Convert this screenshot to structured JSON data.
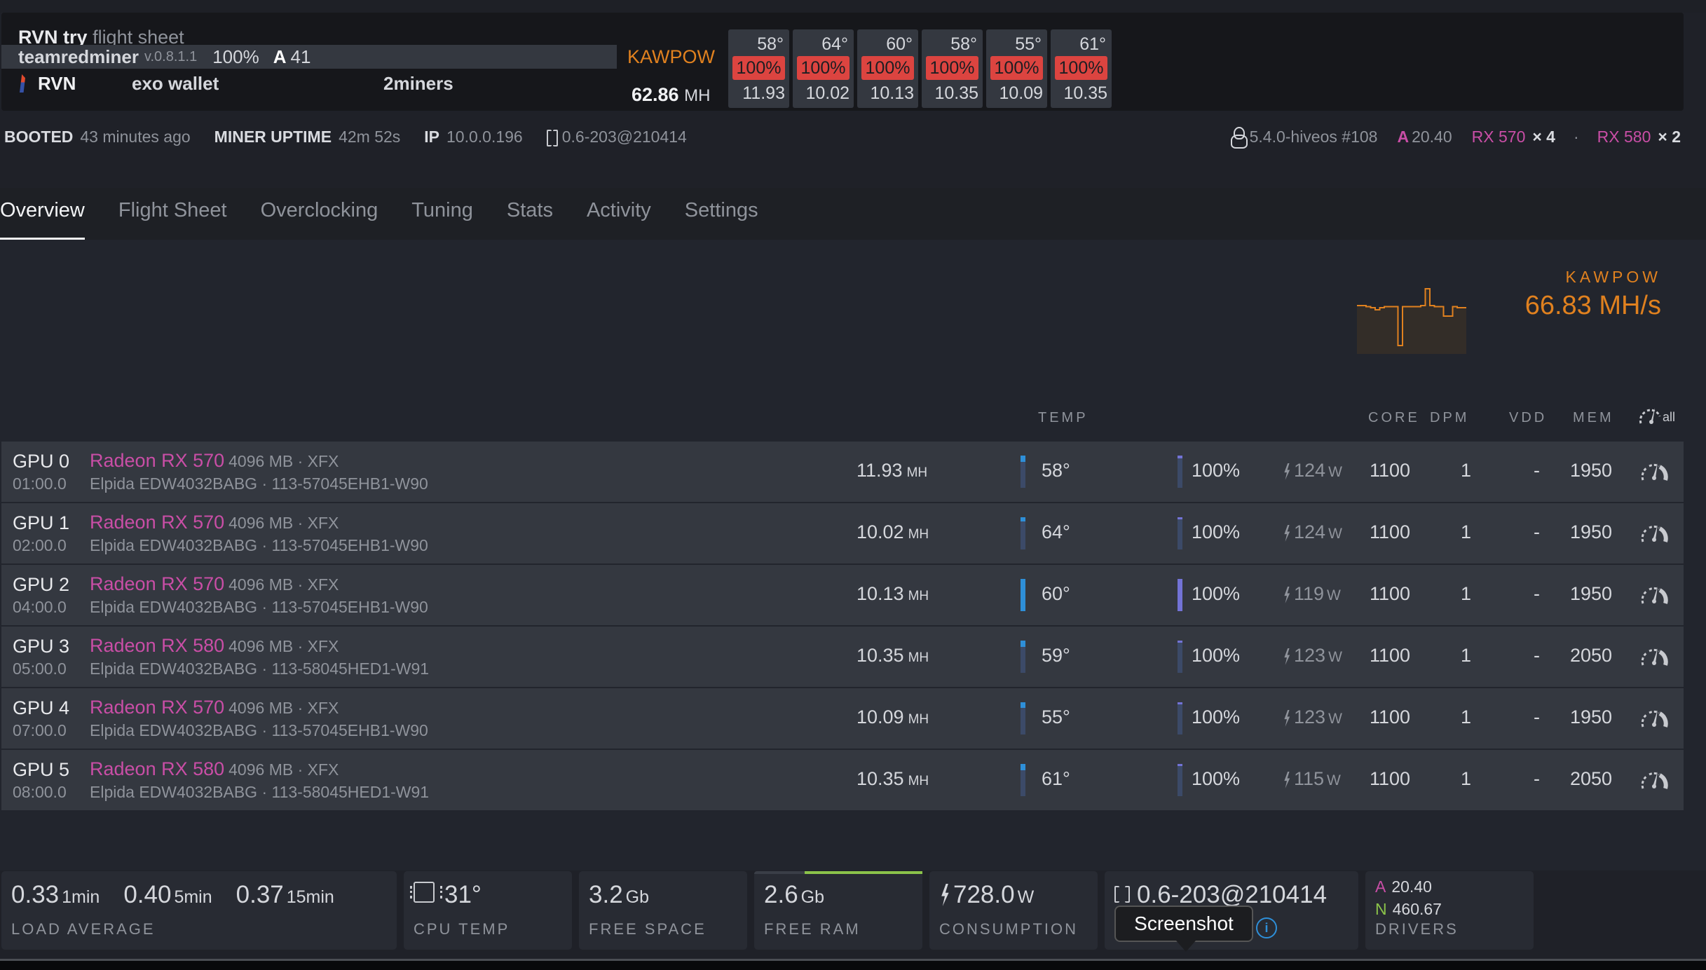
{
  "header": {
    "flight_sheet_name": "RVN try",
    "flight_sheet_suffix": "flight sheet",
    "miner": {
      "name": "teamredminer",
      "version": "v.0.8.1.1",
      "percent": "100%",
      "accepted_label": "A",
      "accepted": "41"
    },
    "algo": "KAWPOW",
    "coin": {
      "icon": "ravencoin-icon",
      "name": "RVN",
      "wallet": "exo wallet",
      "pool": "2miners"
    },
    "total_hashrate": {
      "value": "62.86",
      "unit": "MH"
    },
    "gpu_summary": [
      {
        "temp": "58°",
        "fan": "100%",
        "hash": "11.93"
      },
      {
        "temp": "64°",
        "fan": "100%",
        "hash": "10.02"
      },
      {
        "temp": "60°",
        "fan": "100%",
        "hash": "10.13"
      },
      {
        "temp": "58°",
        "fan": "100%",
        "hash": "10.35"
      },
      {
        "temp": "55°",
        "fan": "100%",
        "hash": "10.09"
      },
      {
        "temp": "61°",
        "fan": "100%",
        "hash": "10.35"
      }
    ]
  },
  "status": {
    "booted_label": "BOOTED",
    "booted": "43 minutes ago",
    "uptime_label": "MINER UPTIME",
    "uptime": "42m 52s",
    "ip_label": "IP",
    "ip": "10.0.0.196",
    "hive_version": "0.6-203@210414",
    "kernel": "5.4.0-hiveos #108",
    "amd_label": "A",
    "amd_driver": "20.40",
    "gpu_types": [
      {
        "model": "RX 570",
        "count": "× 4"
      },
      {
        "model": "RX 580",
        "count": "× 2"
      }
    ],
    "separator": "·"
  },
  "tabs": [
    {
      "label": "Overview",
      "active": true
    },
    {
      "label": "Flight Sheet",
      "active": false
    },
    {
      "label": "Overclocking",
      "active": false
    },
    {
      "label": "Tuning",
      "active": false
    },
    {
      "label": "Stats",
      "active": false
    },
    {
      "label": "Activity",
      "active": false
    },
    {
      "label": "Settings",
      "active": false
    }
  ],
  "overview": {
    "algo": "KAWPOW",
    "hashrate": "66.83 MH/s",
    "sparkline": [
      63,
      63,
      62.5,
      62,
      61,
      62,
      62.5,
      62.5,
      62.5,
      44,
      62.5,
      62.5,
      62.5,
      62.5,
      63,
      71,
      63,
      62.5,
      62.5,
      58,
      58,
      62.5,
      62,
      62
    ]
  },
  "table": {
    "headers": {
      "temp": "TEMP",
      "core": "CORE",
      "dpm": "DPM",
      "vdd": "VDD",
      "mem": "MEM",
      "oc_all": "all"
    },
    "rows": [
      {
        "index": "GPU 0",
        "bus": "01:00.0",
        "model": "Radeon RX 570",
        "details": "4096 MB · XFX",
        "memory": "Elpida EDW4032BABG · 113-57045EHB1-W90",
        "hash": "11.93",
        "hash_unit": "MH",
        "temp": "58°",
        "temp_level": 0.2,
        "fan": "100%",
        "fan_level": 0.08,
        "power": "124",
        "power_unit": "W",
        "core": "1100",
        "dpm": "1",
        "vdd": "-",
        "mem": "1950"
      },
      {
        "index": "GPU 1",
        "bus": "02:00.0",
        "model": "Radeon RX 570",
        "details": "4096 MB · XFX",
        "memory": "Elpida EDW4032BABG · 113-57045EHB1-W90",
        "hash": "10.02",
        "hash_unit": "MH",
        "temp": "64°",
        "temp_level": 0.12,
        "fan": "100%",
        "fan_level": 0.05,
        "power": "124",
        "power_unit": "W",
        "core": "1100",
        "dpm": "1",
        "vdd": "-",
        "mem": "1950"
      },
      {
        "index": "GPU 2",
        "bus": "04:00.0",
        "model": "Radeon RX 570",
        "details": "4096 MB · XFX",
        "memory": "Elpida EDW4032BABG · 113-57045EHB1-W90",
        "hash": "10.13",
        "hash_unit": "MH",
        "temp": "60°",
        "temp_level": 1.0,
        "fan": "100%",
        "fan_level": 1.0,
        "power": "119",
        "power_unit": "W",
        "core": "1100",
        "dpm": "1",
        "vdd": "-",
        "mem": "1950"
      },
      {
        "index": "GPU 3",
        "bus": "05:00.0",
        "model": "Radeon RX 580",
        "details": "4096 MB · XFX",
        "memory": "Elpida EDW4032BABG · 113-58045HED1-W91",
        "hash": "10.35",
        "hash_unit": "MH",
        "temp": "59°",
        "temp_level": 0.2,
        "fan": "100%",
        "fan_level": 0.05,
        "power": "123",
        "power_unit": "W",
        "core": "1100",
        "dpm": "1",
        "vdd": "-",
        "mem": "2050"
      },
      {
        "index": "GPU 4",
        "bus": "07:00.0",
        "model": "Radeon RX 570",
        "details": "4096 MB · XFX",
        "memory": "Elpida EDW4032BABG · 113-57045EHB1-W90",
        "hash": "10.09",
        "hash_unit": "MH",
        "temp": "55°",
        "temp_level": 0.18,
        "fan": "100%",
        "fan_level": 0.05,
        "power": "123",
        "power_unit": "W",
        "core": "1100",
        "dpm": "1",
        "vdd": "-",
        "mem": "1950"
      },
      {
        "index": "GPU 5",
        "bus": "08:00.0",
        "model": "Radeon RX 580",
        "details": "4096 MB · XFX",
        "memory": "Elpida EDW4032BABG · 113-58045HED1-W91",
        "hash": "10.35",
        "hash_unit": "MH",
        "temp": "61°",
        "temp_level": 0.2,
        "fan": "100%",
        "fan_level": 0.05,
        "power": "115",
        "power_unit": "W",
        "core": "1100",
        "dpm": "1",
        "vdd": "-",
        "mem": "2050"
      }
    ]
  },
  "stats": {
    "load": [
      {
        "value": "0.33",
        "unit": "1min"
      },
      {
        "value": "0.40",
        "unit": "5min"
      },
      {
        "value": "0.37",
        "unit": "15min"
      }
    ],
    "load_label": "LOAD AVERAGE",
    "cpu_temp": "31°",
    "cpu_temp_label": "CPU TEMP",
    "free_space": "3.2",
    "free_space_unit": "Gb",
    "free_space_label": "FREE SPACE",
    "free_ram": "2.6",
    "free_ram_unit": "Gb",
    "free_ram_label": "FREE RAM",
    "ram_used_fraction": 0.3,
    "consumption": "728.0",
    "consumption_unit": "W",
    "consumption_label": "CONSUMPTION",
    "hive_version": "0.6-203@210414",
    "drivers": {
      "amd_label": "A",
      "amd": "20.40",
      "nvidia_label": "N",
      "nvidia": "460.67",
      "label": "DRIVERS"
    }
  },
  "tooltip": "Screenshot",
  "colors": {
    "accent_orange": "#e0811f",
    "amd_pink": "#c94ea6",
    "fan_red": "#dc4440",
    "nvidia_green": "#8bc34a",
    "temp_blue": "#2e8fd8"
  }
}
